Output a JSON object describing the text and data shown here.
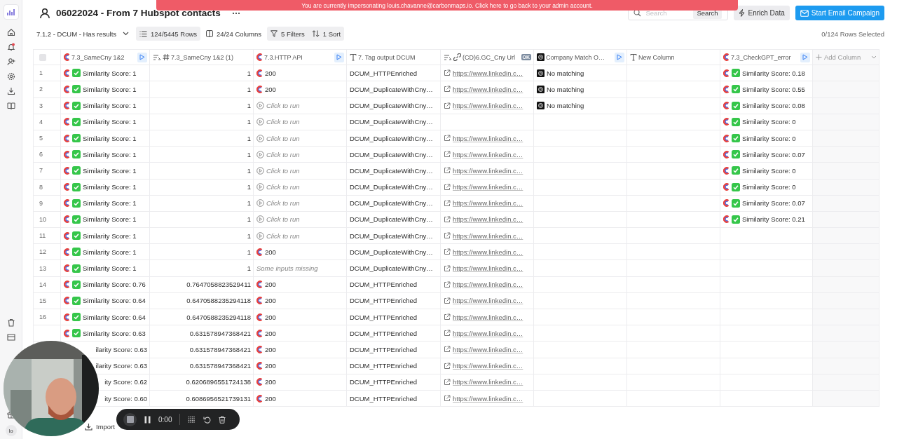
{
  "banner": "You are currently impersonating louis.chavanne@carbonmaps.io. Click here to go back to your admin account.",
  "sidebar": {
    "avatar": "lo"
  },
  "header": {
    "title": "06022024 - From 7 Hubspot contacts",
    "search": {
      "placeholder": "Search",
      "button": "Search"
    },
    "actions": [
      {
        "label": "Enrich Data",
        "kind": "secondary"
      },
      {
        "label": "Start Email Campaign",
        "kind": "primary"
      }
    ]
  },
  "toolbar": {
    "view": "7.1.2 - DCUM - Has results",
    "chips": [
      {
        "label": "124/5445 Rows",
        "kind": "rows",
        "active": true
      },
      {
        "label": "24/24 Columns",
        "kind": "columns",
        "active": false
      },
      {
        "label": "5 Filters",
        "kind": "filters",
        "active": true
      },
      {
        "label": "1 Sort",
        "kind": "sort",
        "active": true
      }
    ],
    "selection": "0/124 Rows Selected"
  },
  "table": {
    "select_all": {
      "checked": false
    },
    "columns": [
      {
        "label": "7.3_SameCny 1&2",
        "kind": "integration",
        "runnable": true
      },
      {
        "label": "7.3_SameCny 1&2 (1)",
        "kind": "formula-number",
        "runnable": false
      },
      {
        "label": "7.3.HTTP API",
        "kind": "integration",
        "runnable": true
      },
      {
        "label": "7. Tag output DCUM",
        "kind": "text",
        "runnable": false
      },
      {
        "label": "(CD)6.GC_Cny Url",
        "kind": "formula-link",
        "runnable": false,
        "badge": "OK"
      },
      {
        "label": "Company Match O…",
        "kind": "ai",
        "runnable": true
      },
      {
        "label": "New Column",
        "kind": "text",
        "runnable": false
      },
      {
        "label": "7.3_CheckGPT_error",
        "kind": "integration",
        "runnable": true
      }
    ],
    "add_column": "Add Column",
    "rows": [
      {
        "num": "1",
        "cells": [
          {
            "kind": "score",
            "text": "Similarity Score: 1"
          },
          {
            "kind": "number",
            "text": "1"
          },
          {
            "kind": "result",
            "text": "200"
          },
          {
            "kind": "text",
            "text": "DCUM_HTTPEnriched"
          },
          {
            "kind": "link",
            "text": "https://www.linkedin.c…"
          },
          {
            "kind": "match",
            "text": "No matching"
          },
          null,
          {
            "kind": "score",
            "text": "Similarity Score: 0.18"
          }
        ]
      },
      {
        "num": "2",
        "cells": [
          {
            "kind": "score",
            "text": "Similarity Score: 1"
          },
          {
            "kind": "number",
            "text": "1"
          },
          {
            "kind": "result",
            "text": "200"
          },
          {
            "kind": "text",
            "text": "DCUM_DuplicateWithCny…"
          },
          {
            "kind": "link",
            "text": "https://www.linkedin.c…"
          },
          {
            "kind": "match",
            "text": "No matching"
          },
          null,
          {
            "kind": "score",
            "text": "Similarity Score: 0.55"
          }
        ]
      },
      {
        "num": "3",
        "cells": [
          {
            "kind": "score",
            "text": "Similarity Score: 1"
          },
          {
            "kind": "number",
            "text": "1"
          },
          {
            "kind": "run",
            "text": "Click to run"
          },
          {
            "kind": "text",
            "text": "DCUM_DuplicateWithCny…"
          },
          {
            "kind": "link",
            "text": "https://www.linkedin.c…"
          },
          {
            "kind": "match",
            "text": "No matching"
          },
          null,
          {
            "kind": "score",
            "text": "Similarity Score: 0.08"
          }
        ]
      },
      {
        "num": "4",
        "cells": [
          {
            "kind": "score",
            "text": "Similarity Score: 1"
          },
          {
            "kind": "number",
            "text": "1"
          },
          {
            "kind": "run",
            "text": "Click to run"
          },
          {
            "kind": "text",
            "text": "DCUM_DuplicateWithCny…"
          },
          null,
          null,
          null,
          {
            "kind": "score",
            "text": "Similarity Score: 0"
          }
        ]
      },
      {
        "num": "5",
        "cells": [
          {
            "kind": "score",
            "text": "Similarity Score: 1"
          },
          {
            "kind": "number",
            "text": "1"
          },
          {
            "kind": "run",
            "text": "Click to run"
          },
          {
            "kind": "text",
            "text": "DCUM_DuplicateWithCny…"
          },
          {
            "kind": "link",
            "text": "https://www.linkedin.c…"
          },
          null,
          null,
          {
            "kind": "score",
            "text": "Similarity Score: 0"
          }
        ]
      },
      {
        "num": "6",
        "cells": [
          {
            "kind": "score",
            "text": "Similarity Score: 1"
          },
          {
            "kind": "number",
            "text": "1"
          },
          {
            "kind": "run",
            "text": "Click to run"
          },
          {
            "kind": "text",
            "text": "DCUM_DuplicateWithCny…"
          },
          {
            "kind": "link",
            "text": "https://www.linkedin.c…"
          },
          null,
          null,
          {
            "kind": "score",
            "text": "Similarity Score: 0.07"
          }
        ]
      },
      {
        "num": "7",
        "cells": [
          {
            "kind": "score",
            "text": "Similarity Score: 1"
          },
          {
            "kind": "number",
            "text": "1"
          },
          {
            "kind": "run",
            "text": "Click to run"
          },
          {
            "kind": "text",
            "text": "DCUM_DuplicateWithCny…"
          },
          {
            "kind": "link",
            "text": "https://www.linkedin.c…"
          },
          null,
          null,
          {
            "kind": "score",
            "text": "Similarity Score: 0"
          }
        ]
      },
      {
        "num": "8",
        "cells": [
          {
            "kind": "score",
            "text": "Similarity Score: 1"
          },
          {
            "kind": "number",
            "text": "1"
          },
          {
            "kind": "run",
            "text": "Click to run"
          },
          {
            "kind": "text",
            "text": "DCUM_DuplicateWithCny…"
          },
          {
            "kind": "link",
            "text": "https://www.linkedin.c…"
          },
          null,
          null,
          {
            "kind": "score",
            "text": "Similarity Score: 0"
          }
        ]
      },
      {
        "num": "9",
        "cells": [
          {
            "kind": "score",
            "text": "Similarity Score: 1"
          },
          {
            "kind": "number",
            "text": "1"
          },
          {
            "kind": "run",
            "text": "Click to run"
          },
          {
            "kind": "text",
            "text": "DCUM_DuplicateWithCny…"
          },
          {
            "kind": "link",
            "text": "https://www.linkedin.c…"
          },
          null,
          null,
          {
            "kind": "score",
            "text": "Similarity Score: 0.07"
          }
        ]
      },
      {
        "num": "10",
        "cells": [
          {
            "kind": "score",
            "text": "Similarity Score: 1"
          },
          {
            "kind": "number",
            "text": "1"
          },
          {
            "kind": "run",
            "text": "Click to run"
          },
          {
            "kind": "text",
            "text": "DCUM_DuplicateWithCny…"
          },
          {
            "kind": "link",
            "text": "https://www.linkedin.c…"
          },
          null,
          null,
          {
            "kind": "score",
            "text": "Similarity Score: 0.21"
          }
        ]
      },
      {
        "num": "11",
        "cells": [
          {
            "kind": "score",
            "text": "Similarity Score: 1"
          },
          {
            "kind": "number",
            "text": "1"
          },
          {
            "kind": "run",
            "text": "Click to run"
          },
          {
            "kind": "text",
            "text": "DCUM_DuplicateWithCny…"
          },
          {
            "kind": "link",
            "text": "https://www.linkedin.c…"
          },
          null,
          null,
          null
        ]
      },
      {
        "num": "12",
        "cells": [
          {
            "kind": "score",
            "text": "Similarity Score: 1"
          },
          {
            "kind": "number",
            "text": "1"
          },
          {
            "kind": "result",
            "text": "200"
          },
          {
            "kind": "text",
            "text": "DCUM_DuplicateWithCny…"
          },
          {
            "kind": "link",
            "text": "https://www.linkedin.c…"
          },
          null,
          null,
          null
        ]
      },
      {
        "num": "13",
        "cells": [
          {
            "kind": "score",
            "text": "Similarity Score: 1"
          },
          {
            "kind": "number",
            "text": "1"
          },
          {
            "kind": "missing",
            "text": "Some inputs missing"
          },
          {
            "kind": "text",
            "text": "DCUM_DuplicateWithCny…"
          },
          {
            "kind": "link",
            "text": "https://www.linkedin.c…"
          },
          null,
          null,
          null
        ]
      },
      {
        "num": "14",
        "cells": [
          {
            "kind": "score",
            "text": "Similarity Score: 0.76"
          },
          {
            "kind": "number",
            "text": "0.7647058823529411"
          },
          {
            "kind": "result",
            "text": "200"
          },
          {
            "kind": "text",
            "text": "DCUM_HTTPEnriched"
          },
          {
            "kind": "link",
            "text": "https://www.linkedin.c…"
          },
          null,
          null,
          null
        ]
      },
      {
        "num": "15",
        "cells": [
          {
            "kind": "score",
            "text": "Similarity Score: 0.64"
          },
          {
            "kind": "number",
            "text": "0.6470588235294118"
          },
          {
            "kind": "result",
            "text": "200"
          },
          {
            "kind": "text",
            "text": "DCUM_HTTPEnriched"
          },
          {
            "kind": "link",
            "text": "https://www.linkedin.c…"
          },
          null,
          null,
          null
        ]
      },
      {
        "num": "16",
        "cells": [
          {
            "kind": "score",
            "text": "Similarity Score: 0.64"
          },
          {
            "kind": "number",
            "text": "0.6470588235294118"
          },
          {
            "kind": "result",
            "text": "200"
          },
          {
            "kind": "text",
            "text": "DCUM_HTTPEnriched"
          },
          {
            "kind": "link",
            "text": "https://www.linkedin.c…"
          },
          null,
          null,
          null
        ]
      },
      {
        "cells": [
          {
            "kind": "score",
            "text": "Similarity Score: 0.63"
          },
          {
            "kind": "number",
            "text": "0.631578947368421"
          },
          {
            "kind": "result",
            "text": "200"
          },
          {
            "kind": "text",
            "text": "DCUM_HTTPEnriched"
          },
          {
            "kind": "link",
            "text": "https://www.linkedin.c…"
          },
          null,
          null,
          null
        ]
      },
      {
        "cells": [
          {
            "kind": "score",
            "text": "ilarity Score: 0.63",
            "covered": true
          },
          {
            "kind": "number",
            "text": "0.631578947368421"
          },
          {
            "kind": "result",
            "text": "200"
          },
          {
            "kind": "text",
            "text": "DCUM_HTTPEnriched"
          },
          {
            "kind": "link",
            "text": "https://www.linkedin.c…"
          },
          null,
          null,
          null
        ]
      },
      {
        "cells": [
          {
            "kind": "score",
            "text": "ilarity Score: 0.63",
            "covered": true
          },
          {
            "kind": "number",
            "text": "0.631578947368421"
          },
          {
            "kind": "result",
            "text": "200"
          },
          {
            "kind": "text",
            "text": "DCUM_HTTPEnriched"
          },
          {
            "kind": "link",
            "text": "https://www.linkedin.c…"
          },
          null,
          null,
          null
        ]
      },
      {
        "cells": [
          {
            "kind": "score",
            "text": "ity Score: 0.62",
            "covered": true
          },
          {
            "kind": "number",
            "text": "0.6206896551724138"
          },
          {
            "kind": "result",
            "text": "200"
          },
          {
            "kind": "text",
            "text": "DCUM_HTTPEnriched"
          },
          {
            "kind": "link",
            "text": "https://www.linkedin.c…"
          },
          null,
          null,
          null
        ]
      },
      {
        "cells": [
          {
            "kind": "score",
            "text": "ity Score: 0.60",
            "covered": true
          },
          {
            "kind": "number",
            "text": "0.6086956521739131"
          },
          {
            "kind": "result",
            "text": "200"
          },
          {
            "kind": "text",
            "text": "DCUM_HTTPEnriched"
          },
          {
            "kind": "link",
            "text": "https://www.linkedin.c…"
          },
          null,
          null,
          null
        ]
      }
    ]
  },
  "footer": {
    "import": "Import"
  },
  "recorder": {
    "time": "0:00"
  }
}
